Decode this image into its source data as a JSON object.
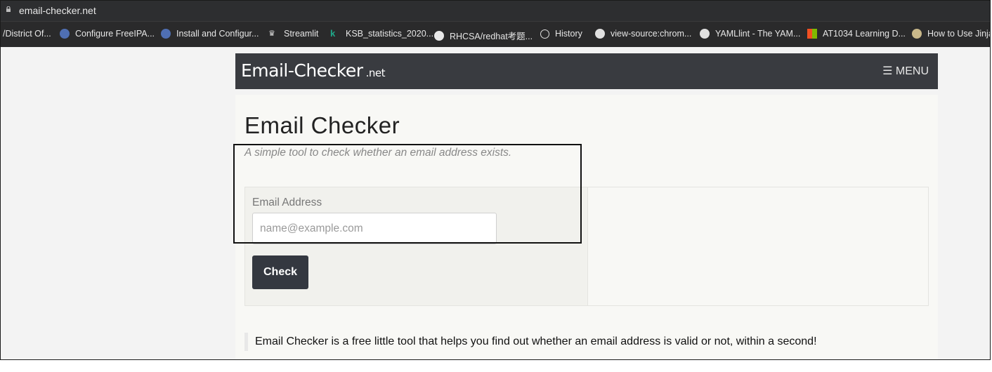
{
  "browser": {
    "url": "email-checker.net",
    "bookmarks": [
      {
        "label": "/District Of...",
        "icon": "none"
      },
      {
        "label": "Configure FreeIPA...",
        "icon": "ipa-icon"
      },
      {
        "label": "Install and Configur...",
        "icon": "ipa-icon"
      },
      {
        "label": "Streamlit",
        "icon": "crown-icon"
      },
      {
        "label": "KSB_statistics_2020...",
        "icon": "k-icon"
      },
      {
        "label": "RHCSA/redhat考题...",
        "icon": "github-icon"
      },
      {
        "label": "History",
        "icon": "history-icon"
      },
      {
        "label": "view-source:chrom...",
        "icon": "globe-icon"
      },
      {
        "label": "YAMLlint - The YAM...",
        "icon": "globe-icon"
      },
      {
        "label": "AT1034 Learning D...",
        "icon": "microsoft-icon"
      },
      {
        "label": "How to Use Jinja...",
        "icon": "jinja-icon"
      }
    ]
  },
  "navbar": {
    "brand": "Email-Checker",
    "brand_suffix": ".net",
    "menu_label": "☰ MENU"
  },
  "main": {
    "title": "Email Checker",
    "subtitle": "A simple tool to check whether an email address exists.",
    "form": {
      "label": "Email Address",
      "placeholder": "name@example.com",
      "value": "",
      "button_label": "Check"
    },
    "description": "Email Checker is a free little tool that helps you find out whether an email address is valid or not, within a second!"
  },
  "colors": {
    "navbar": "#393b40",
    "button": "#343840",
    "browser_chrome": "#2d2e30"
  }
}
